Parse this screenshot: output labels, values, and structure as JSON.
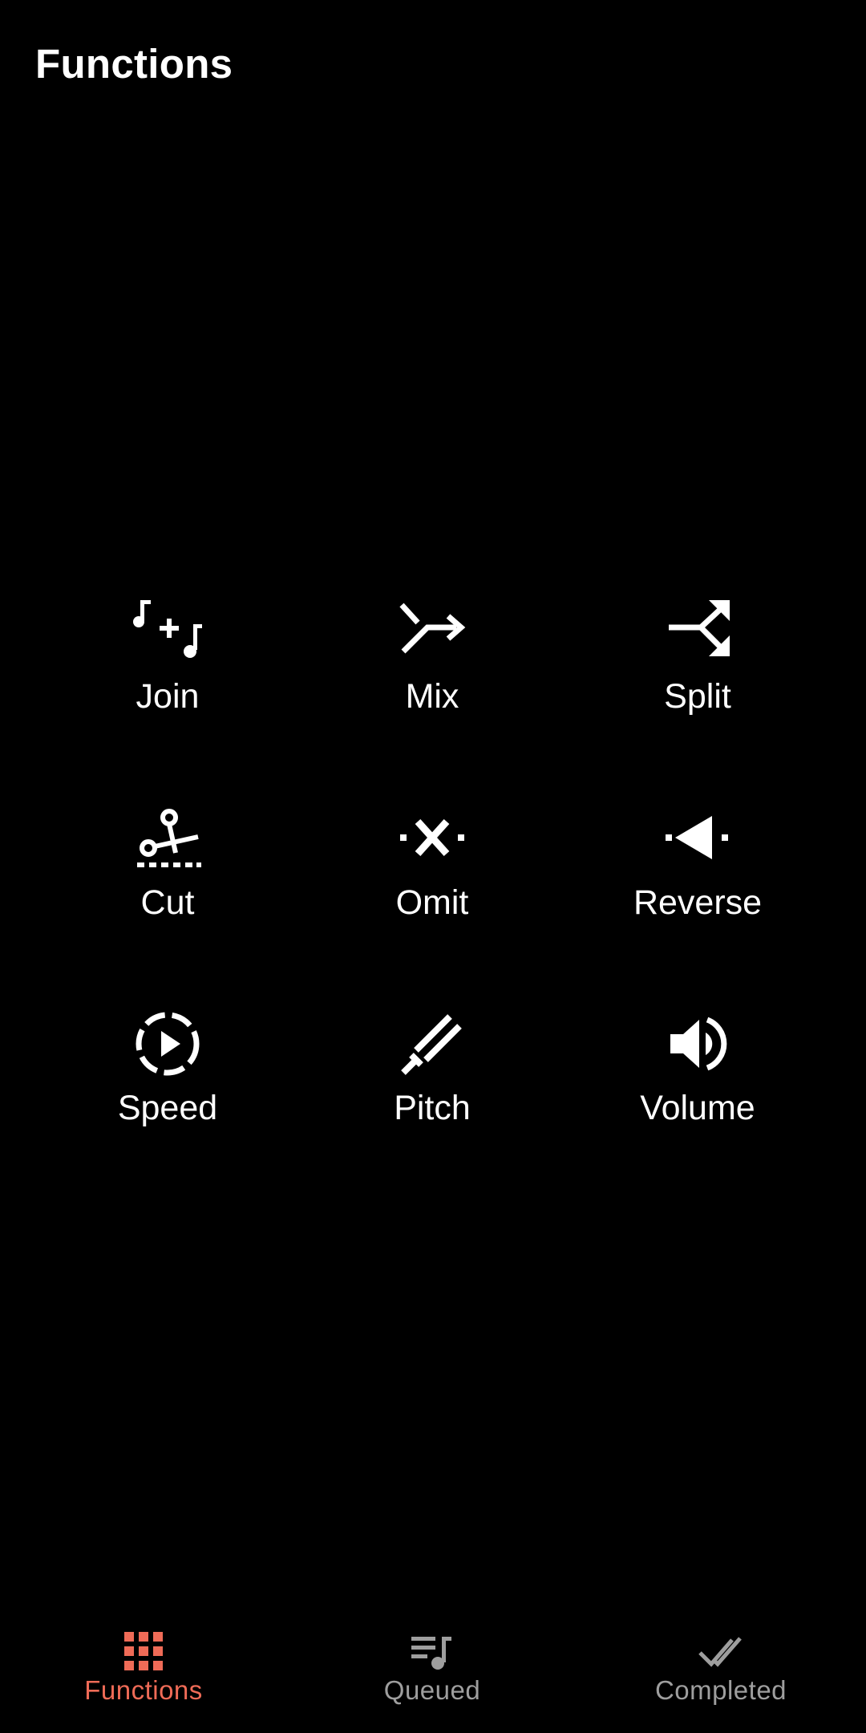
{
  "header": {
    "title": "Functions"
  },
  "functions": [
    {
      "label": "Join",
      "icon": "join-music-icon"
    },
    {
      "label": "Mix",
      "icon": "mix-arrows-icon"
    },
    {
      "label": "Split",
      "icon": "split-arrows-icon"
    },
    {
      "label": "Cut",
      "icon": "cut-scissors-icon"
    },
    {
      "label": "Omit",
      "icon": "omit-x-icon"
    },
    {
      "label": "Reverse",
      "icon": "reverse-arrow-icon"
    },
    {
      "label": "Speed",
      "icon": "speed-play-icon"
    },
    {
      "label": "Pitch",
      "icon": "pitch-fork-icon"
    },
    {
      "label": "Volume",
      "icon": "volume-speaker-icon"
    }
  ],
  "bottom_nav": {
    "items": [
      {
        "label": "Functions",
        "icon": "grid-icon",
        "active": true
      },
      {
        "label": "Queued",
        "icon": "queue-music-icon",
        "active": false
      },
      {
        "label": "Completed",
        "icon": "double-check-icon",
        "active": false
      }
    ],
    "active_color": "#EF6B57",
    "inactive_color": "#9E9E9E"
  },
  "colors": {
    "background": "#000000",
    "text": "#FFFFFF"
  }
}
